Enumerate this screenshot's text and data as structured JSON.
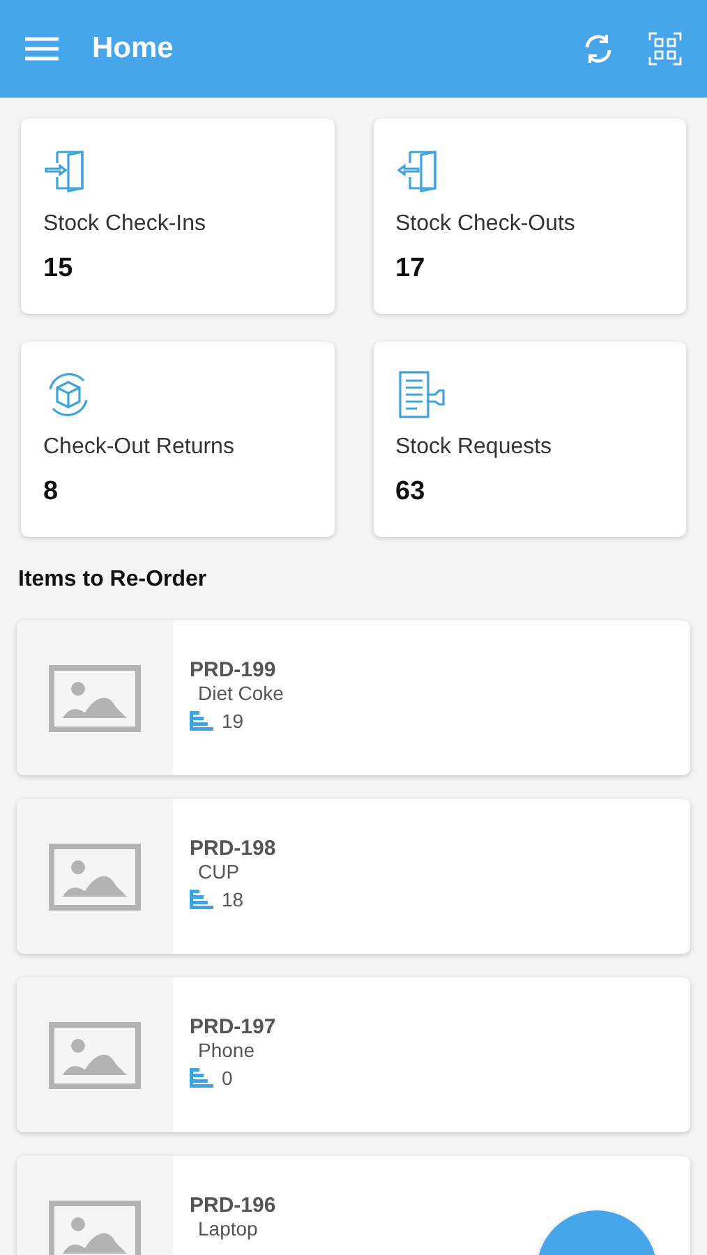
{
  "app_bar": {
    "title": "Home"
  },
  "stats": [
    {
      "kind": "check-in",
      "label": "Stock Check-Ins",
      "count": "15"
    },
    {
      "kind": "check-out",
      "label": "Stock Check-Outs",
      "count": "17"
    },
    {
      "kind": "returns",
      "label": "Check-Out Returns",
      "count": "8"
    },
    {
      "kind": "requests",
      "label": "Stock Requests",
      "count": "63"
    }
  ],
  "reorder": {
    "title": "Items to Re-Order",
    "items": [
      {
        "code": "PRD-199",
        "name": "Diet Coke",
        "quantity": "19"
      },
      {
        "code": "PRD-198",
        "name": "CUP",
        "quantity": "18"
      },
      {
        "code": "PRD-197",
        "name": "Phone",
        "quantity": "0"
      },
      {
        "code": "PRD-196",
        "name": "Laptop"
      }
    ]
  }
}
